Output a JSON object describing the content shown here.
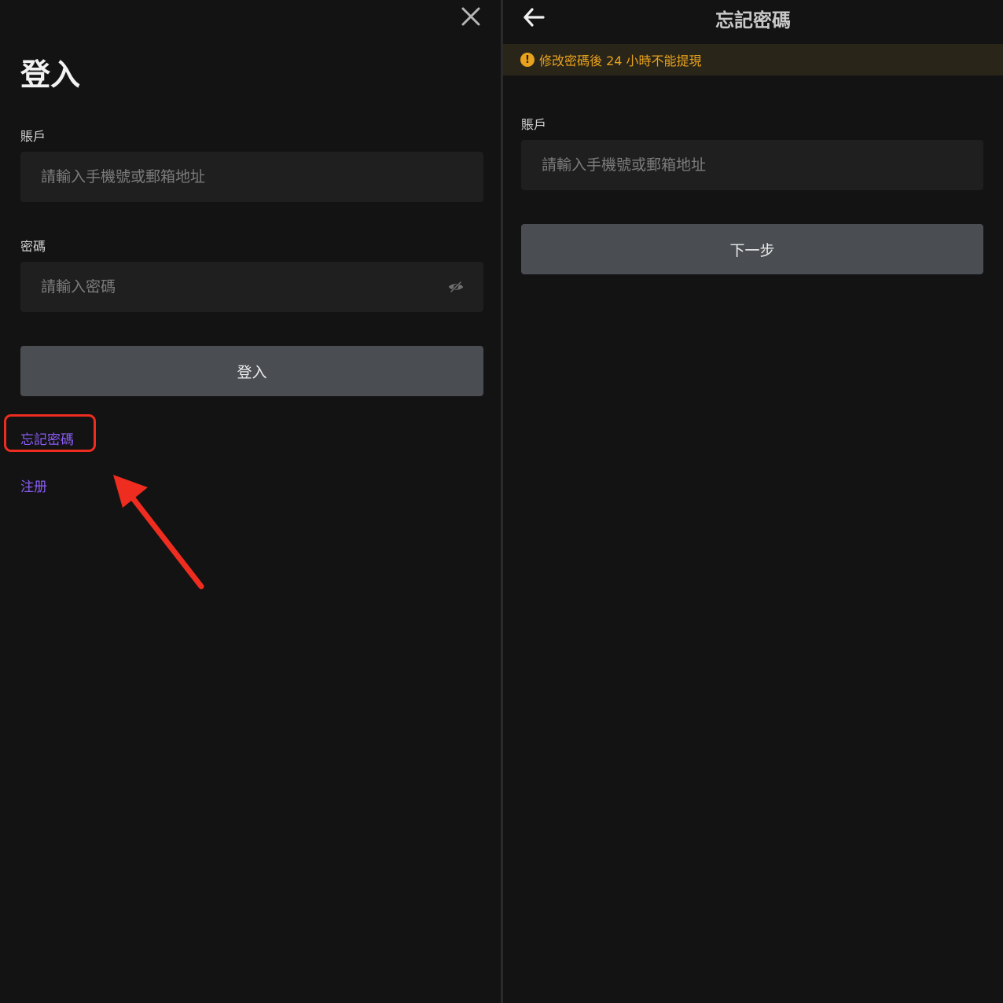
{
  "login": {
    "title": "登入",
    "account_label": "賬戶",
    "account_placeholder": "請輸入手機號或郵箱地址",
    "password_label": "密碼",
    "password_placeholder": "請輸入密碼",
    "submit_label": "登入",
    "forgot_password_link": "忘記密碼",
    "register_link": "注册"
  },
  "forgot": {
    "header_title": "忘記密碼",
    "notice_icon": "!",
    "notice_text": "修改密碼後 24 小時不能提現",
    "account_label": "賬戶",
    "account_placeholder": "請輸入手機號或郵箱地址",
    "next_label": "下一步"
  },
  "colors": {
    "background": "#131313",
    "input_background": "#1f1f1f",
    "button_background": "#4a4d51",
    "link_purple": "#8a5cf5",
    "notice_amber": "#e8a21d",
    "annotation_red": "#ee2c1f"
  },
  "icons": {
    "close": "close-icon",
    "eye": "eye-off-icon",
    "back": "back-arrow-icon",
    "notice": "info-icon"
  }
}
